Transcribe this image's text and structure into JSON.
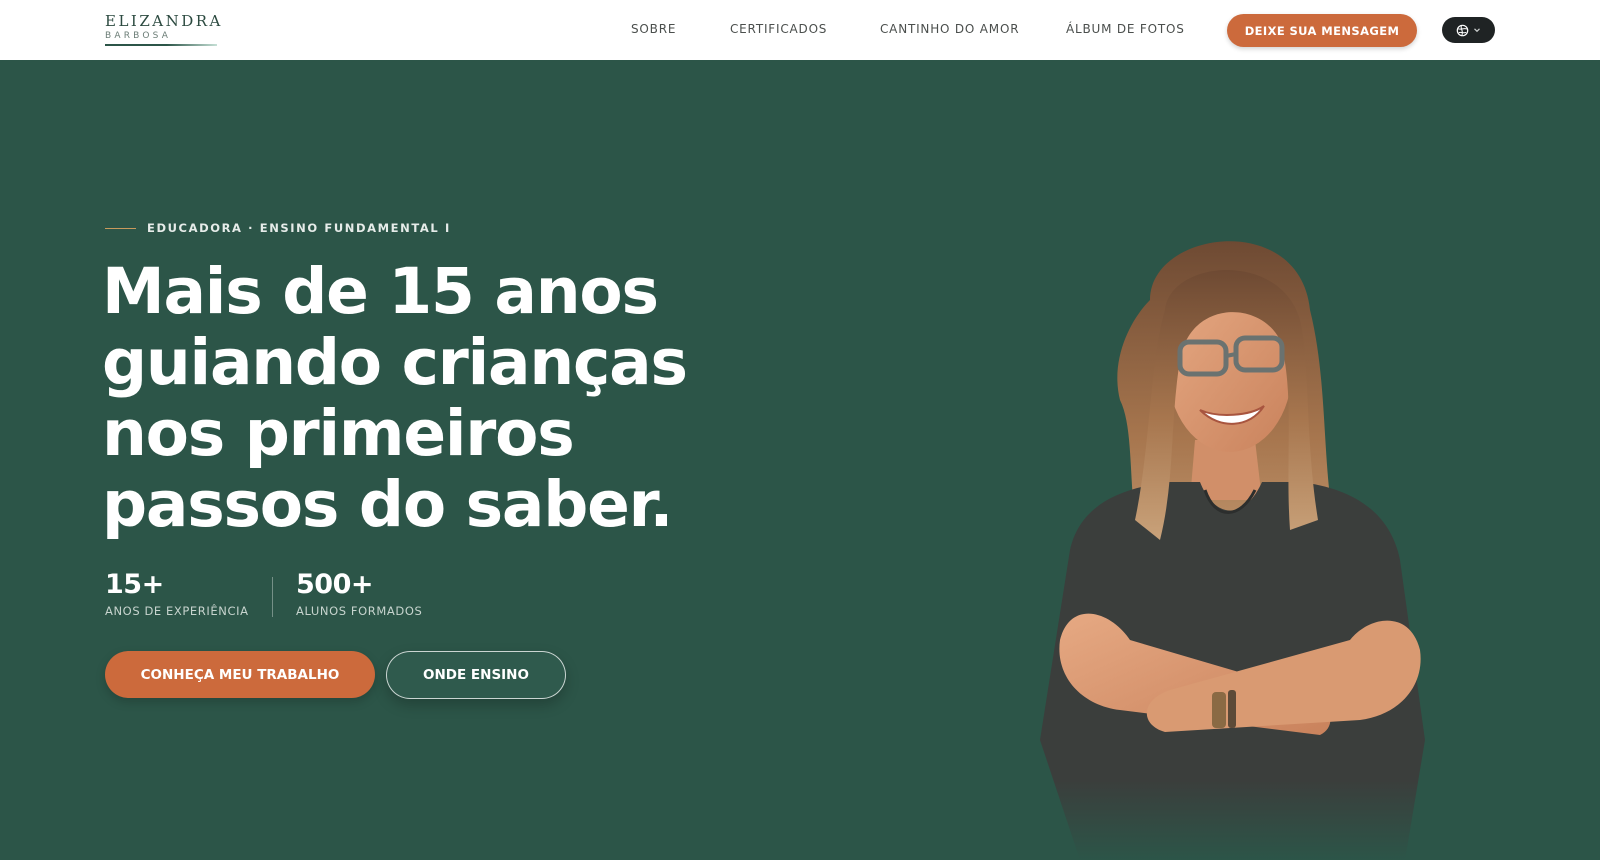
{
  "brand": {
    "name": "ELIZANDRA",
    "subtitle": "BARBOSA"
  },
  "nav": {
    "links": [
      "SOBRE",
      "CERTIFICADOS",
      "CANTINHO DO AMOR",
      "ÁLBUM DE FOTOS"
    ],
    "cta_label": "DEIXE SUA MENSAGEM",
    "language_icon": "globe-icon"
  },
  "hero": {
    "eyebrow": "EDUCADORA · ENSINO FUNDAMENTAL I",
    "headline_lines": [
      "Mais de 15 anos",
      "guiando crianças",
      "nos primeiros",
      "passos do saber."
    ],
    "stats": [
      {
        "value": "15+",
        "label": "ANOS DE EXPERIÊNCIA"
      },
      {
        "value": "500+",
        "label": "ALUNOS FORMADOS"
      }
    ],
    "primary_button": "CONHEÇA MEU TRABALHO",
    "secondary_button": "ONDE ENSINO"
  },
  "colors": {
    "background": "#2c5548",
    "accent": "#cc6a3c",
    "header": "#ffffff"
  }
}
